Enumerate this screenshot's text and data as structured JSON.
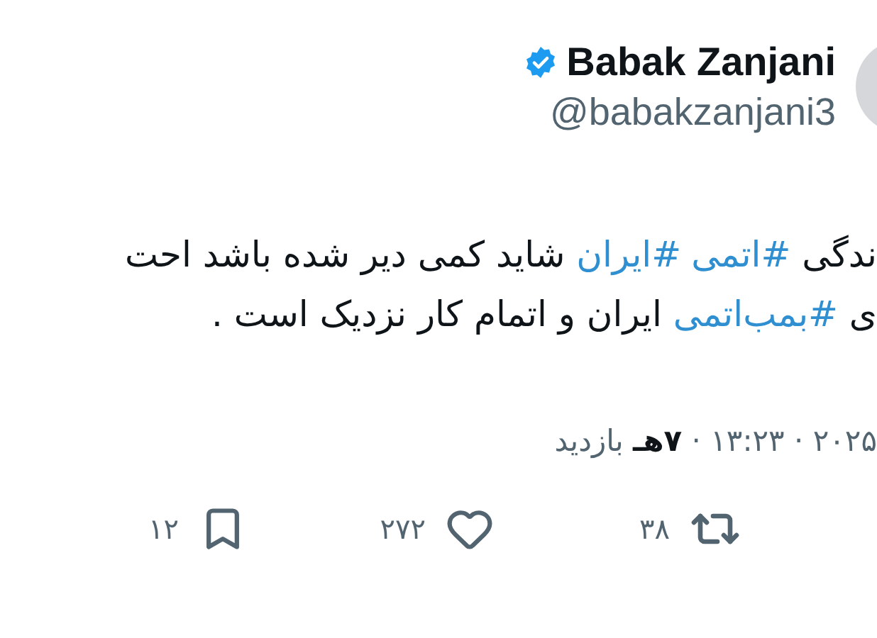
{
  "author": {
    "name": "Babak Zanjani",
    "handle": "@babakzanjani3",
    "verified": true
  },
  "tweet_lines": [
    [
      {
        "kind": "text",
        "text": "ندگی "
      },
      {
        "kind": "hashtag",
        "text": "#اتمی"
      },
      {
        "kind": "hashtag",
        "text": "#ایران"
      },
      {
        "kind": "text",
        "text": " شاید کمی دیر شده باشد احت"
      }
    ],
    [
      {
        "kind": "text",
        "text": "ی "
      },
      {
        "kind": "hashtag",
        "text": "#بمب‌اتمی"
      },
      {
        "kind": "text",
        "text": " ایران و اتمام کار نزدیک است ."
      }
    ]
  ],
  "meta": "۲۰۲۵ · ۱۳:۲۳ · **۷هـ** بازدید",
  "stats": [
    {
      "kind": "retweet",
      "count": "۳۸"
    },
    {
      "kind": "like",
      "count": "۲۷۲"
    },
    {
      "kind": "bookmark",
      "count": "۱۲"
    }
  ]
}
